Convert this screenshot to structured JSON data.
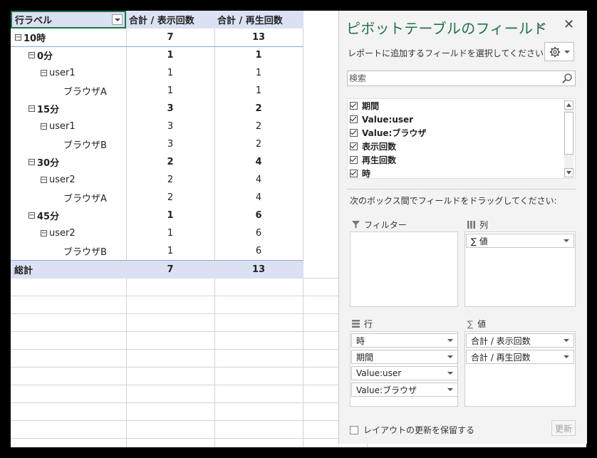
{
  "pivot": {
    "header": {
      "row_label": "行ラベル",
      "col1": "合計 / 表示回数",
      "col2": "合計 / 再生回数"
    },
    "rows": [
      {
        "label": "10時",
        "v1": "7",
        "v2": "13"
      },
      {
        "label": "0分",
        "v1": "1",
        "v2": "1"
      },
      {
        "label": "user1",
        "v1": "1",
        "v2": "1"
      },
      {
        "label": "ブラウザA",
        "v1": "1",
        "v2": "1"
      },
      {
        "label": "15分",
        "v1": "3",
        "v2": "2"
      },
      {
        "label": "user1",
        "v1": "3",
        "v2": "2"
      },
      {
        "label": "ブラウザB",
        "v1": "3",
        "v2": "2"
      },
      {
        "label": "30分",
        "v1": "2",
        "v2": "4"
      },
      {
        "label": "user2",
        "v1": "2",
        "v2": "4"
      },
      {
        "label": "ブラウザA",
        "v1": "2",
        "v2": "4"
      },
      {
        "label": "45分",
        "v1": "1",
        "v2": "6"
      },
      {
        "label": "user2",
        "v1": "1",
        "v2": "6"
      },
      {
        "label": "ブラウザB",
        "v1": "1",
        "v2": "6"
      }
    ],
    "total": {
      "label": "総計",
      "v1": "7",
      "v2": "13"
    }
  },
  "pane": {
    "title": "ピボットテーブルのフィールド",
    "close": "✕",
    "choose_label": "レポートに追加するフィールドを選択してください:",
    "search_placeholder": "検索",
    "fields": [
      "期間",
      "Value:user",
      "Value:ブラウザ",
      "表示回数",
      "再生回数",
      "時"
    ],
    "drag_label": "次のボックス間でフィールドをドラッグしてください:",
    "areas": {
      "filters": {
        "title": "フィルター",
        "items": []
      },
      "columns": {
        "title": "列",
        "items": [
          "値"
        ]
      },
      "rows": {
        "title": "行",
        "items": [
          "時",
          "期間",
          "Value:user",
          "Value:ブラウザ"
        ]
      },
      "values": {
        "title": "値",
        "items": [
          "合計 / 表示回数",
          "合計 / 再生回数"
        ]
      }
    },
    "sigma": "∑",
    "defer_label": "レイアウトの更新を保留する",
    "update_label": "更新"
  },
  "colors": {
    "accent": "#217346",
    "header_fill": "#d9e1f2"
  }
}
